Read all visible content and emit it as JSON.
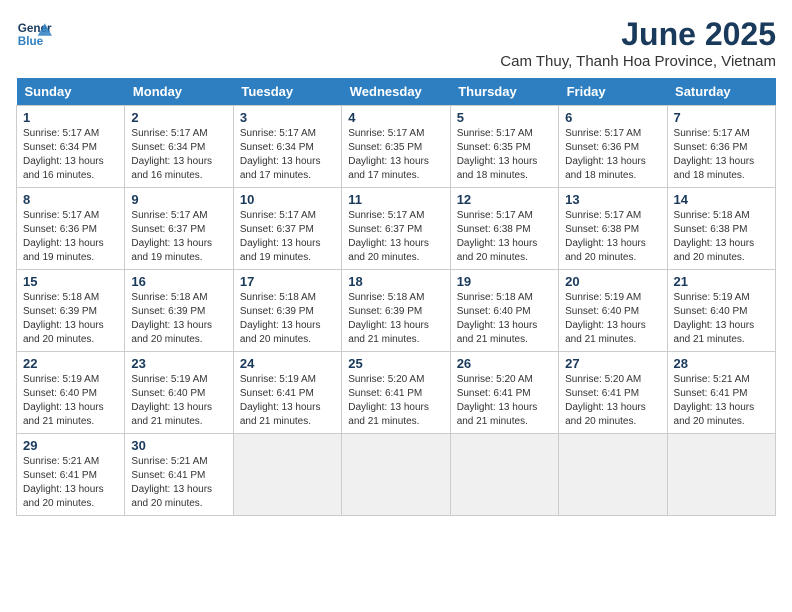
{
  "logo": {
    "line1": "General",
    "line2": "Blue"
  },
  "title": "June 2025",
  "subtitle": "Cam Thuy, Thanh Hoa Province, Vietnam",
  "headers": [
    "Sunday",
    "Monday",
    "Tuesday",
    "Wednesday",
    "Thursday",
    "Friday",
    "Saturday"
  ],
  "weeks": [
    [
      {
        "day": "1",
        "sunrise": "5:17 AM",
        "sunset": "6:34 PM",
        "daylight": "13 hours and 16 minutes."
      },
      {
        "day": "2",
        "sunrise": "5:17 AM",
        "sunset": "6:34 PM",
        "daylight": "13 hours and 16 minutes."
      },
      {
        "day": "3",
        "sunrise": "5:17 AM",
        "sunset": "6:34 PM",
        "daylight": "13 hours and 17 minutes."
      },
      {
        "day": "4",
        "sunrise": "5:17 AM",
        "sunset": "6:35 PM",
        "daylight": "13 hours and 17 minutes."
      },
      {
        "day": "5",
        "sunrise": "5:17 AM",
        "sunset": "6:35 PM",
        "daylight": "13 hours and 18 minutes."
      },
      {
        "day": "6",
        "sunrise": "5:17 AM",
        "sunset": "6:36 PM",
        "daylight": "13 hours and 18 minutes."
      },
      {
        "day": "7",
        "sunrise": "5:17 AM",
        "sunset": "6:36 PM",
        "daylight": "13 hours and 18 minutes."
      }
    ],
    [
      {
        "day": "8",
        "sunrise": "5:17 AM",
        "sunset": "6:36 PM",
        "daylight": "13 hours and 19 minutes."
      },
      {
        "day": "9",
        "sunrise": "5:17 AM",
        "sunset": "6:37 PM",
        "daylight": "13 hours and 19 minutes."
      },
      {
        "day": "10",
        "sunrise": "5:17 AM",
        "sunset": "6:37 PM",
        "daylight": "13 hours and 19 minutes."
      },
      {
        "day": "11",
        "sunrise": "5:17 AM",
        "sunset": "6:37 PM",
        "daylight": "13 hours and 20 minutes."
      },
      {
        "day": "12",
        "sunrise": "5:17 AM",
        "sunset": "6:38 PM",
        "daylight": "13 hours and 20 minutes."
      },
      {
        "day": "13",
        "sunrise": "5:17 AM",
        "sunset": "6:38 PM",
        "daylight": "13 hours and 20 minutes."
      },
      {
        "day": "14",
        "sunrise": "5:18 AM",
        "sunset": "6:38 PM",
        "daylight": "13 hours and 20 minutes."
      }
    ],
    [
      {
        "day": "15",
        "sunrise": "5:18 AM",
        "sunset": "6:39 PM",
        "daylight": "13 hours and 20 minutes."
      },
      {
        "day": "16",
        "sunrise": "5:18 AM",
        "sunset": "6:39 PM",
        "daylight": "13 hours and 20 minutes."
      },
      {
        "day": "17",
        "sunrise": "5:18 AM",
        "sunset": "6:39 PM",
        "daylight": "13 hours and 20 minutes."
      },
      {
        "day": "18",
        "sunrise": "5:18 AM",
        "sunset": "6:39 PM",
        "daylight": "13 hours and 21 minutes."
      },
      {
        "day": "19",
        "sunrise": "5:18 AM",
        "sunset": "6:40 PM",
        "daylight": "13 hours and 21 minutes."
      },
      {
        "day": "20",
        "sunrise": "5:19 AM",
        "sunset": "6:40 PM",
        "daylight": "13 hours and 21 minutes."
      },
      {
        "day": "21",
        "sunrise": "5:19 AM",
        "sunset": "6:40 PM",
        "daylight": "13 hours and 21 minutes."
      }
    ],
    [
      {
        "day": "22",
        "sunrise": "5:19 AM",
        "sunset": "6:40 PM",
        "daylight": "13 hours and 21 minutes."
      },
      {
        "day": "23",
        "sunrise": "5:19 AM",
        "sunset": "6:40 PM",
        "daylight": "13 hours and 21 minutes."
      },
      {
        "day": "24",
        "sunrise": "5:19 AM",
        "sunset": "6:41 PM",
        "daylight": "13 hours and 21 minutes."
      },
      {
        "day": "25",
        "sunrise": "5:20 AM",
        "sunset": "6:41 PM",
        "daylight": "13 hours and 21 minutes."
      },
      {
        "day": "26",
        "sunrise": "5:20 AM",
        "sunset": "6:41 PM",
        "daylight": "13 hours and 21 minutes."
      },
      {
        "day": "27",
        "sunrise": "5:20 AM",
        "sunset": "6:41 PM",
        "daylight": "13 hours and 20 minutes."
      },
      {
        "day": "28",
        "sunrise": "5:21 AM",
        "sunset": "6:41 PM",
        "daylight": "13 hours and 20 minutes."
      }
    ],
    [
      {
        "day": "29",
        "sunrise": "5:21 AM",
        "sunset": "6:41 PM",
        "daylight": "13 hours and 20 minutes."
      },
      {
        "day": "30",
        "sunrise": "5:21 AM",
        "sunset": "6:41 PM",
        "daylight": "13 hours and 20 minutes."
      },
      null,
      null,
      null,
      null,
      null
    ]
  ],
  "labels": {
    "sunrise": "Sunrise: ",
    "sunset": "Sunset: ",
    "daylight": "Daylight: "
  }
}
